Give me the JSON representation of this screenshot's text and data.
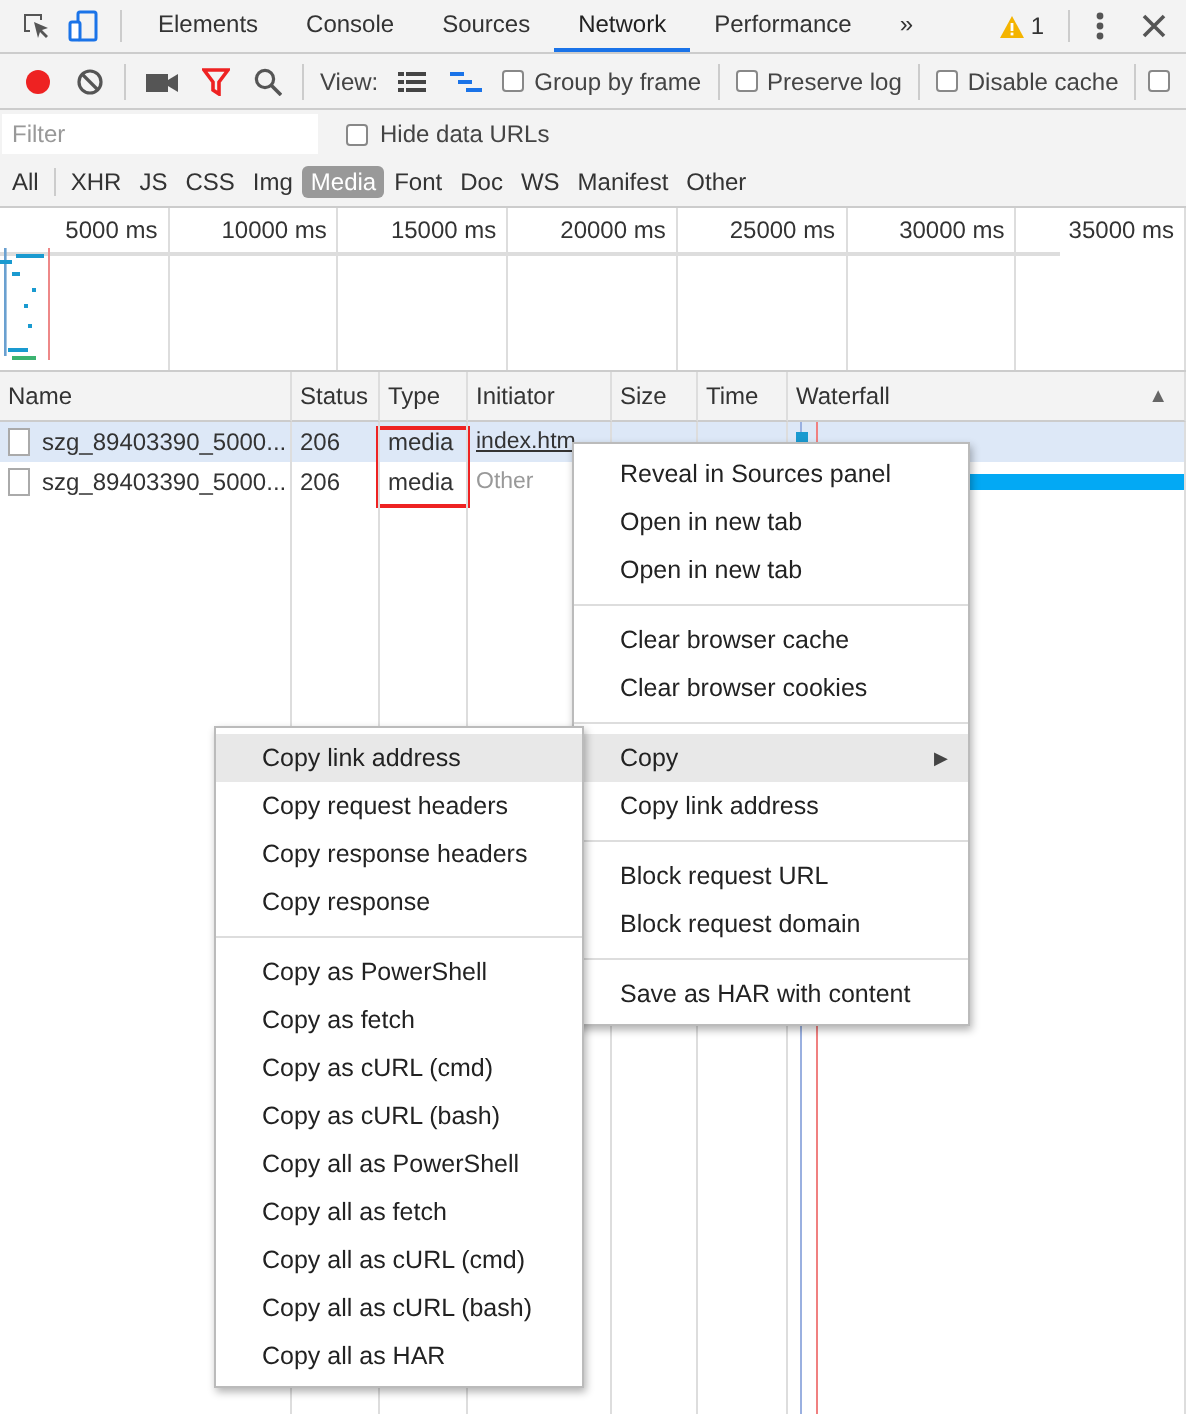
{
  "tabs": [
    {
      "label": "Elements",
      "selected": false
    },
    {
      "label": "Console",
      "selected": false
    },
    {
      "label": "Sources",
      "selected": false
    },
    {
      "label": "Network",
      "selected": true
    },
    {
      "label": "Performance",
      "selected": false
    }
  ],
  "tab_overflow": "»",
  "warning_count": "1",
  "toolbar": {
    "recording": true,
    "view_label": "View:",
    "checkboxes": [
      {
        "label": "Group by frame",
        "checked": false
      },
      {
        "label": "Preserve log",
        "checked": false
      },
      {
        "label": "Disable cache",
        "checked": false
      }
    ],
    "cut_checkbox": {
      "checked": false
    }
  },
  "filter": {
    "placeholder": "Filter",
    "hide_data_urls": {
      "label": "Hide data URLs",
      "checked": false
    }
  },
  "type_filters": [
    {
      "label": "All",
      "selected": false
    },
    {
      "label": "XHR",
      "selected": false
    },
    {
      "label": "JS",
      "selected": false
    },
    {
      "label": "CSS",
      "selected": false
    },
    {
      "label": "Img",
      "selected": false
    },
    {
      "label": "Media",
      "selected": true
    },
    {
      "label": "Font",
      "selected": false
    },
    {
      "label": "Doc",
      "selected": false
    },
    {
      "label": "WS",
      "selected": false
    },
    {
      "label": "Manifest",
      "selected": false
    },
    {
      "label": "Other",
      "selected": false
    }
  ],
  "overview_ticks": [
    "5000 ms",
    "10000 ms",
    "15000 ms",
    "20000 ms",
    "25000 ms",
    "30000 ms",
    "35000 ms"
  ],
  "columns": [
    "Name",
    "Status",
    "Type",
    "Initiator",
    "Size",
    "Time",
    "Waterfall"
  ],
  "sort_indicator": "▲",
  "rows": [
    {
      "name": "szg_89403390_5000...",
      "status": "206",
      "type": "media",
      "initiator": "index.htm",
      "is_link": true,
      "selected": true
    },
    {
      "name": "szg_89403390_5000...",
      "status": "206",
      "type": "media",
      "initiator": "Other",
      "is_link": false,
      "selected": false
    }
  ],
  "context_menu": [
    {
      "kind": "item",
      "label": "Reveal in Sources panel"
    },
    {
      "kind": "item",
      "label": "Open in new tab"
    },
    {
      "kind": "item",
      "label": "Open in new tab"
    },
    {
      "kind": "separator"
    },
    {
      "kind": "item",
      "label": "Clear browser cache"
    },
    {
      "kind": "item",
      "label": "Clear browser cookies"
    },
    {
      "kind": "separator"
    },
    {
      "kind": "submenu",
      "label": "Copy",
      "arrow": "▶",
      "selected": true
    },
    {
      "kind": "item",
      "label": "Copy link address"
    },
    {
      "kind": "separator"
    },
    {
      "kind": "item",
      "label": "Block request URL"
    },
    {
      "kind": "item",
      "label": "Block request domain"
    },
    {
      "kind": "separator"
    },
    {
      "kind": "item",
      "label": "Save as HAR with content"
    }
  ],
  "copy_submenu": [
    {
      "kind": "item",
      "label": "Copy link address",
      "selected": true
    },
    {
      "kind": "item",
      "label": "Copy request headers",
      "selected": false
    },
    {
      "kind": "item",
      "label": "Copy response headers",
      "selected": false
    },
    {
      "kind": "item",
      "label": "Copy response",
      "selected": false
    },
    {
      "kind": "separator"
    },
    {
      "kind": "item",
      "label": "Copy as PowerShell",
      "selected": false
    },
    {
      "kind": "item",
      "label": "Copy as fetch",
      "selected": false
    },
    {
      "kind": "item",
      "label": "Copy as cURL (cmd)",
      "selected": false
    },
    {
      "kind": "item",
      "label": "Copy as cURL (bash)",
      "selected": false
    },
    {
      "kind": "item",
      "label": "Copy all as PowerShell",
      "selected": false
    },
    {
      "kind": "item",
      "label": "Copy all as fetch",
      "selected": false
    },
    {
      "kind": "item",
      "label": "Copy all as cURL (cmd)",
      "selected": false
    },
    {
      "kind": "item",
      "label": "Copy all as cURL (bash)",
      "selected": false
    },
    {
      "kind": "item",
      "label": "Copy all as HAR",
      "selected": false
    }
  ]
}
